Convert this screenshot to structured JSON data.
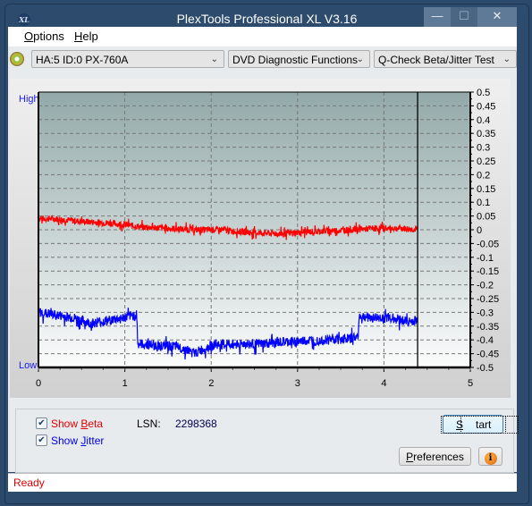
{
  "window": {
    "title": "PlexTools Professional XL V3.16",
    "app_icon": "XL",
    "controls": {
      "minimize": "—",
      "maximize": "☐",
      "close": "✕"
    }
  },
  "menu": [
    {
      "label": "Options",
      "mnemonic": "O",
      "rest": "ptions"
    },
    {
      "label": "Help",
      "mnemonic": "H",
      "rest": "elp"
    }
  ],
  "toolbar": {
    "drive": "HA:5 ID:0  PX-760A",
    "function": "DVD Diagnostic Functions",
    "test": "Q-Check Beta/Jitter Test",
    "chevron": "⌄"
  },
  "chart_labels": {
    "high": "High",
    "low": "Low"
  },
  "chart_data": {
    "type": "line",
    "title": "",
    "xlabel": "",
    "ylabel": "",
    "xlim": [
      0,
      5
    ],
    "ylim": [
      -0.5,
      0.5
    ],
    "x_ticks": [
      "0",
      "1",
      "2",
      "3",
      "4",
      "5"
    ],
    "y_ticks": [
      "0.5",
      "0.45",
      "0.4",
      "0.35",
      "0.3",
      "0.25",
      "0.2",
      "0.15",
      "0.1",
      "0.05",
      "0",
      "-0.05",
      "-0.1",
      "-0.15",
      "-0.2",
      "-0.25",
      "-0.3",
      "-0.35",
      "-0.4",
      "-0.45",
      "-0.5"
    ],
    "grid": true,
    "end_marker_x": 4.39,
    "series": [
      {
        "name": "Beta",
        "color": "#ff0000",
        "x": [
          0,
          0.2,
          0.5,
          0.8,
          0.95,
          1.2,
          1.5,
          1.8,
          2.1,
          2.25,
          2.5,
          2.8,
          3.0,
          3.3,
          3.6,
          3.9,
          4.2,
          4.39
        ],
        "y": [
          0.04,
          0.04,
          0.03,
          0.025,
          0.02,
          0.01,
          0.005,
          0.0,
          0.0,
          -0.005,
          -0.01,
          -0.015,
          -0.01,
          -0.005,
          0.0,
          0.005,
          0.005,
          0.0
        ],
        "noise": 0.012
      },
      {
        "name": "Jitter",
        "color": "#0000ff",
        "x": [
          0,
          0.2,
          0.4,
          0.6,
          0.8,
          1.0,
          1.1,
          1.14,
          1.15,
          1.4,
          1.6,
          1.75,
          1.8,
          2.0,
          2.3,
          2.6,
          3.0,
          3.3,
          3.6,
          3.7,
          3.71,
          3.9,
          4.1,
          4.3,
          4.39
        ],
        "y": [
          -0.3,
          -0.31,
          -0.32,
          -0.34,
          -0.33,
          -0.32,
          -0.31,
          -0.32,
          -0.415,
          -0.42,
          -0.425,
          -0.44,
          -0.45,
          -0.42,
          -0.415,
          -0.415,
          -0.405,
          -0.4,
          -0.395,
          -0.39,
          -0.315,
          -0.32,
          -0.32,
          -0.335,
          -0.33
        ],
        "noise": 0.018
      }
    ]
  },
  "controls": {
    "show_beta": {
      "label_pre": "Show ",
      "mnemonic": "B",
      "label_post": "eta",
      "checked": true,
      "color": "#e00000"
    },
    "show_jitter": {
      "label_pre": "Show ",
      "mnemonic": "J",
      "label_post": "itter",
      "checked": true,
      "color": "#0000e0"
    },
    "lsn_label": "LSN:",
    "lsn_value": "2298368",
    "start_mnemonic": "S",
    "start_rest": "tart",
    "prefs_mnemonic": "P",
    "prefs_rest": "references",
    "info_glyph": "i"
  },
  "status": {
    "text": "Ready"
  }
}
